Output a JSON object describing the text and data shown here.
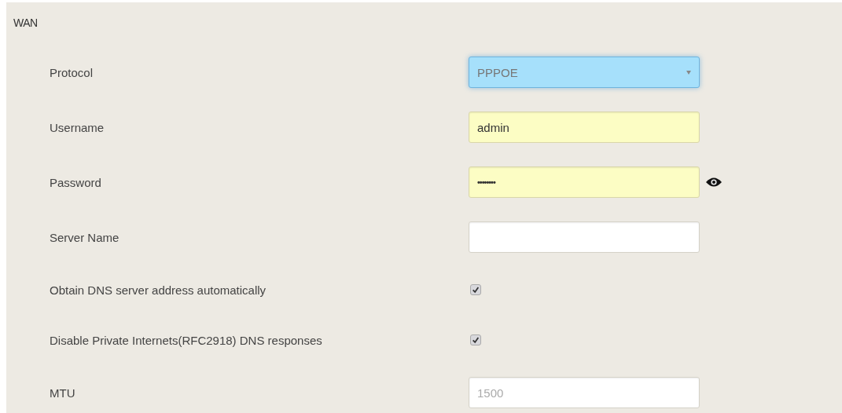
{
  "section": {
    "title": "WAN"
  },
  "fields": [
    {
      "kind": "select",
      "label": "Protocol",
      "value": "PPPOE",
      "focused": true
    },
    {
      "kind": "text",
      "label": "Username",
      "value": "admin",
      "autofilled": true
    },
    {
      "kind": "password",
      "label": "Password",
      "value": "••••••••",
      "autofilled": true
    },
    {
      "kind": "text",
      "label": "Server Name"
    },
    {
      "kind": "checkbox",
      "label": "Obtain DNS server address automatically",
      "checked": true
    },
    {
      "kind": "checkbox",
      "label": "Disable Private Internets(RFC2918) DNS responses",
      "checked": true
    },
    {
      "kind": "text",
      "label": "MTU",
      "placeholder": "1500"
    }
  ]
}
